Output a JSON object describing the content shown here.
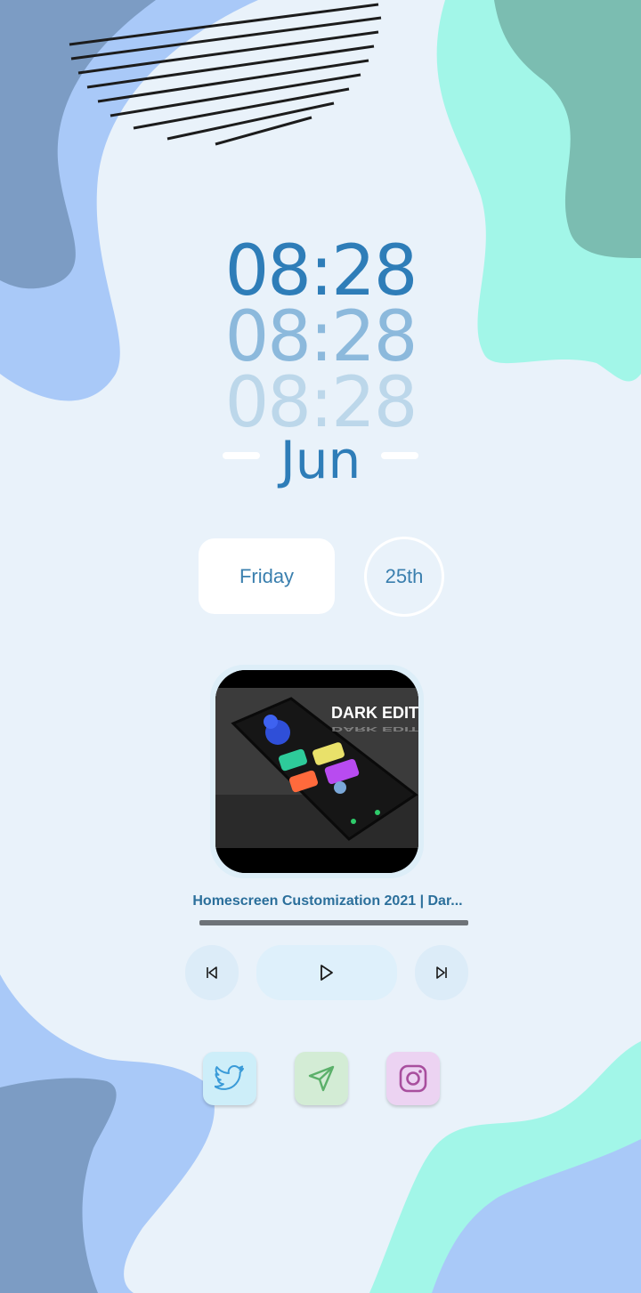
{
  "clock": {
    "line1": "08:28",
    "line2": "08:28",
    "line3": "08:28",
    "month": "Jun"
  },
  "date": {
    "weekday": "Friday",
    "day": "25th"
  },
  "media": {
    "artwork_caption": "DARK EDIT",
    "title": "Homescreen Customization 2021 | Dar...",
    "progress": 1.0,
    "controls": {
      "previous": "skip-previous-icon",
      "play": "play-icon",
      "next": "skip-next-icon"
    }
  },
  "social": [
    {
      "name": "twitter",
      "icon": "twitter-icon",
      "color": "#3a9bd8"
    },
    {
      "name": "telegram",
      "icon": "send-icon",
      "color": "#5bb06a"
    },
    {
      "name": "instagram",
      "icon": "instagram-icon",
      "color": "#a84f9e"
    }
  ],
  "colors": {
    "accent": "#2e7db8",
    "background": "#e9f2fa"
  }
}
